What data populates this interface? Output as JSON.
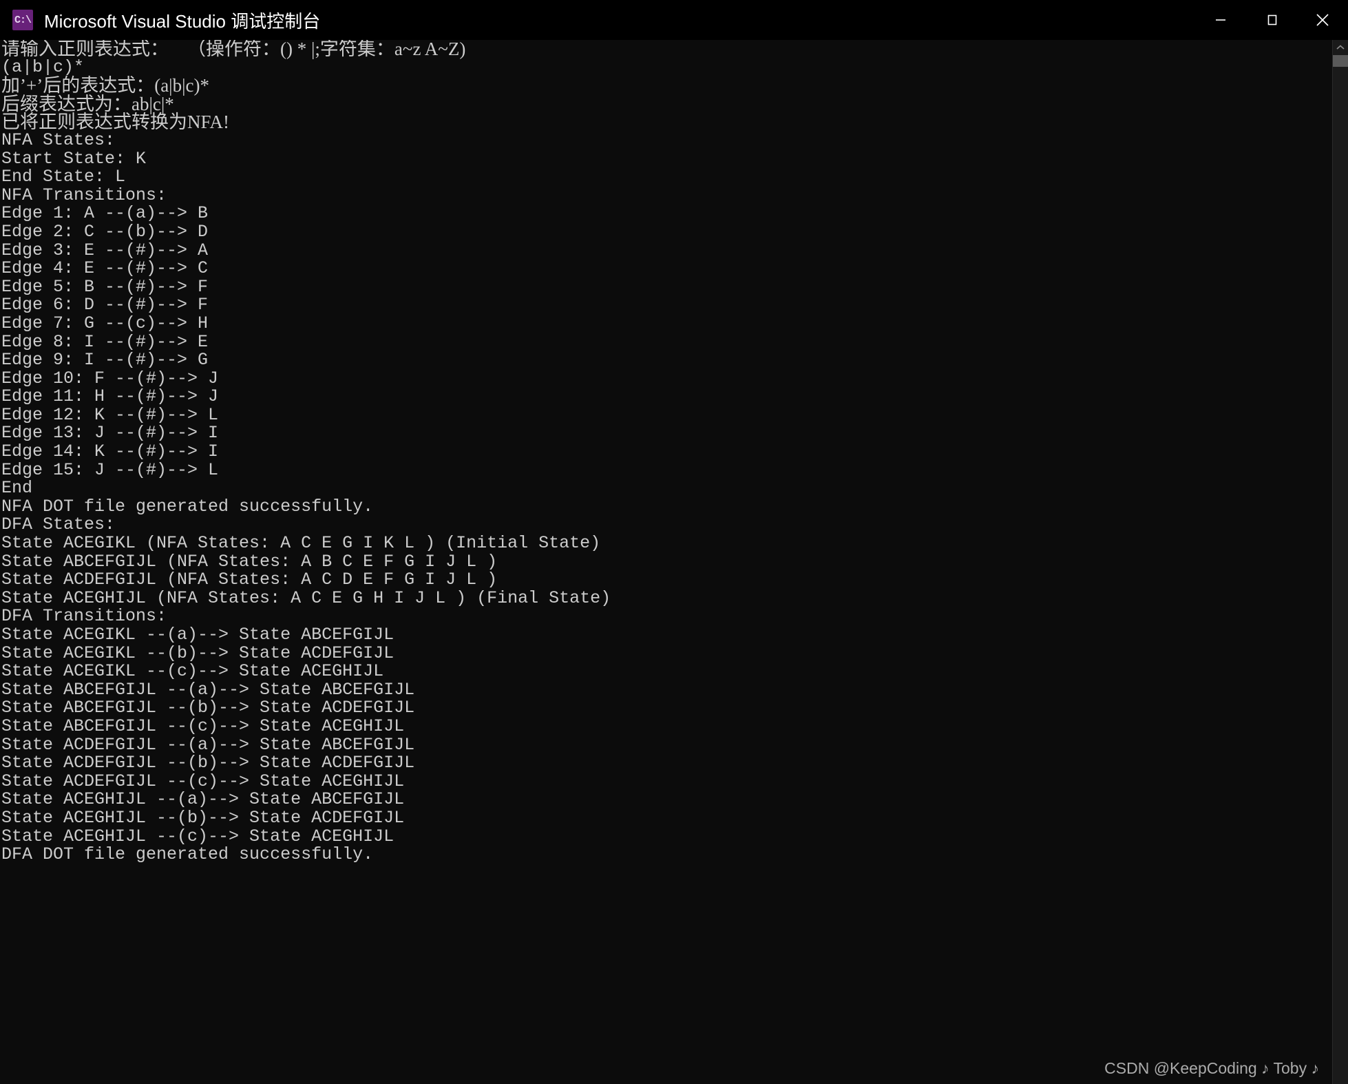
{
  "window": {
    "title": "Microsoft Visual Studio 调试控制台",
    "app_icon_glyph": "C:\\",
    "icon_color": "#68217a",
    "titlebar_bg": "#000000",
    "console_bg": "#0c0c0c",
    "text_color": "#cccccc",
    "controls": {
      "minimize_label": "最小化",
      "maximize_label": "最大化",
      "close_label": "关闭"
    }
  },
  "scrollbar": {
    "up_arrow_label": "向上滚动",
    "thumb_label": "滚动条滑块"
  },
  "watermark": {
    "text": "CSDN @KeepCoding ♪ Toby ♪"
  },
  "console": {
    "lines": [
      {
        "text": "请输入正则表达式：    （操作符：() * |;字符集：a~z A~Z)",
        "cjk": true
      },
      {
        "text": "(a|b|c)*",
        "cjk": false
      },
      {
        "text": "加’+’后的表达式：(a|b|c)*",
        "cjk": true
      },
      {
        "text": "后缀表达式为：ab|c|*",
        "cjk": true
      },
      {
        "text": "已将正则表达式转换为NFA!",
        "cjk": true
      },
      {
        "text": "NFA States:",
        "cjk": false
      },
      {
        "text": "Start State: K",
        "cjk": false
      },
      {
        "text": "End State: L",
        "cjk": false
      },
      {
        "text": "NFA Transitions:",
        "cjk": false
      },
      {
        "text": "Edge 1: A --(a)--> B",
        "cjk": false
      },
      {
        "text": "Edge 2: C --(b)--> D",
        "cjk": false
      },
      {
        "text": "Edge 3: E --(#)--> A",
        "cjk": false
      },
      {
        "text": "Edge 4: E --(#)--> C",
        "cjk": false
      },
      {
        "text": "Edge 5: B --(#)--> F",
        "cjk": false
      },
      {
        "text": "Edge 6: D --(#)--> F",
        "cjk": false
      },
      {
        "text": "Edge 7: G --(c)--> H",
        "cjk": false
      },
      {
        "text": "Edge 8: I --(#)--> E",
        "cjk": false
      },
      {
        "text": "Edge 9: I --(#)--> G",
        "cjk": false
      },
      {
        "text": "Edge 10: F --(#)--> J",
        "cjk": false
      },
      {
        "text": "Edge 11: H --(#)--> J",
        "cjk": false
      },
      {
        "text": "Edge 12: K --(#)--> L",
        "cjk": false
      },
      {
        "text": "Edge 13: J --(#)--> I",
        "cjk": false
      },
      {
        "text": "Edge 14: K --(#)--> I",
        "cjk": false
      },
      {
        "text": "Edge 15: J --(#)--> L",
        "cjk": false
      },
      {
        "text": "End",
        "cjk": false
      },
      {
        "text": "NFA DOT file generated successfully.",
        "cjk": false
      },
      {
        "text": "DFA States:",
        "cjk": false
      },
      {
        "text": "State ACEGIKL (NFA States: A C E G I K L ) (Initial State)",
        "cjk": false
      },
      {
        "text": "State ABCEFGIJL (NFA States: A B C E F G I J L )",
        "cjk": false
      },
      {
        "text": "State ACDEFGIJL (NFA States: A C D E F G I J L )",
        "cjk": false
      },
      {
        "text": "State ACEGHIJL (NFA States: A C E G H I J L ) (Final State)",
        "cjk": false
      },
      {
        "text": "DFA Transitions:",
        "cjk": false
      },
      {
        "text": "State ACEGIKL --(a)--> State ABCEFGIJL",
        "cjk": false
      },
      {
        "text": "State ACEGIKL --(b)--> State ACDEFGIJL",
        "cjk": false
      },
      {
        "text": "State ACEGIKL --(c)--> State ACEGHIJL",
        "cjk": false
      },
      {
        "text": "State ABCEFGIJL --(a)--> State ABCEFGIJL",
        "cjk": false
      },
      {
        "text": "State ABCEFGIJL --(b)--> State ACDEFGIJL",
        "cjk": false
      },
      {
        "text": "State ABCEFGIJL --(c)--> State ACEGHIJL",
        "cjk": false
      },
      {
        "text": "State ACDEFGIJL --(a)--> State ABCEFGIJL",
        "cjk": false
      },
      {
        "text": "State ACDEFGIJL --(b)--> State ACDEFGIJL",
        "cjk": false
      },
      {
        "text": "State ACDEFGIJL --(c)--> State ACEGHIJL",
        "cjk": false
      },
      {
        "text": "State ACEGHIJL --(a)--> State ABCEFGIJL",
        "cjk": false
      },
      {
        "text": "State ACEGHIJL --(b)--> State ACDEFGIJL",
        "cjk": false
      },
      {
        "text": "State ACEGHIJL --(c)--> State ACEGHIJL",
        "cjk": false
      },
      {
        "text": "DFA DOT file generated successfully.",
        "cjk": false
      }
    ]
  }
}
